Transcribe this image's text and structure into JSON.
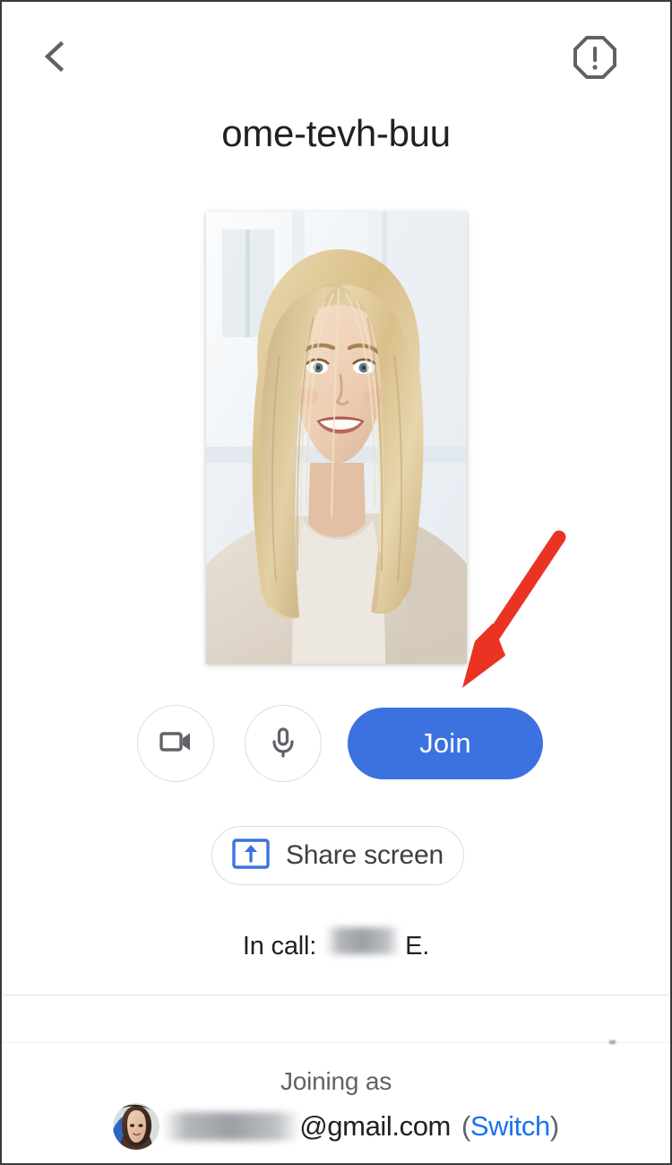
{
  "window": {
    "app": "Google Meet",
    "background_color": "#ffffff"
  },
  "topbar": {
    "back_icon": "chevron-left-icon",
    "back_label": "Back",
    "warning_icon": "report-problem-octagon-icon",
    "warning_label": "Report a problem",
    "icon_color": "#5f6368"
  },
  "meeting": {
    "code": "ome-tevh-buu"
  },
  "video_preview": {
    "type": "self-view-camera-preview",
    "description": "Portrait photo of a smiling blonde woman in a light beige sweater, bright window background"
  },
  "annotation": {
    "type": "arrow",
    "color": "#ea3323",
    "points_to": "join-button"
  },
  "controls": {
    "camera": {
      "icon": "videocam-icon",
      "label": "Turn off camera",
      "state": "on"
    },
    "microphone": {
      "icon": "mic-icon",
      "label": "Mute microphone",
      "state": "on"
    },
    "join_label": "Join",
    "join_color": "#3c72e0"
  },
  "share_screen": {
    "icon": "present-to-screen-icon",
    "icon_color": "#3c72e0",
    "label": "Share screen"
  },
  "in_call": {
    "prefix": "In call:",
    "participant_first_name_redacted": true,
    "participant_last_initial": "E."
  },
  "footer": {
    "joining_as_label": "Joining as",
    "avatar": "user-avatar",
    "email_local_redacted": true,
    "email_domain": "@gmail.com",
    "switch_open_paren": "(",
    "switch_label": "Switch",
    "switch_close_paren": ")",
    "switch_color": "#1a73e8"
  }
}
